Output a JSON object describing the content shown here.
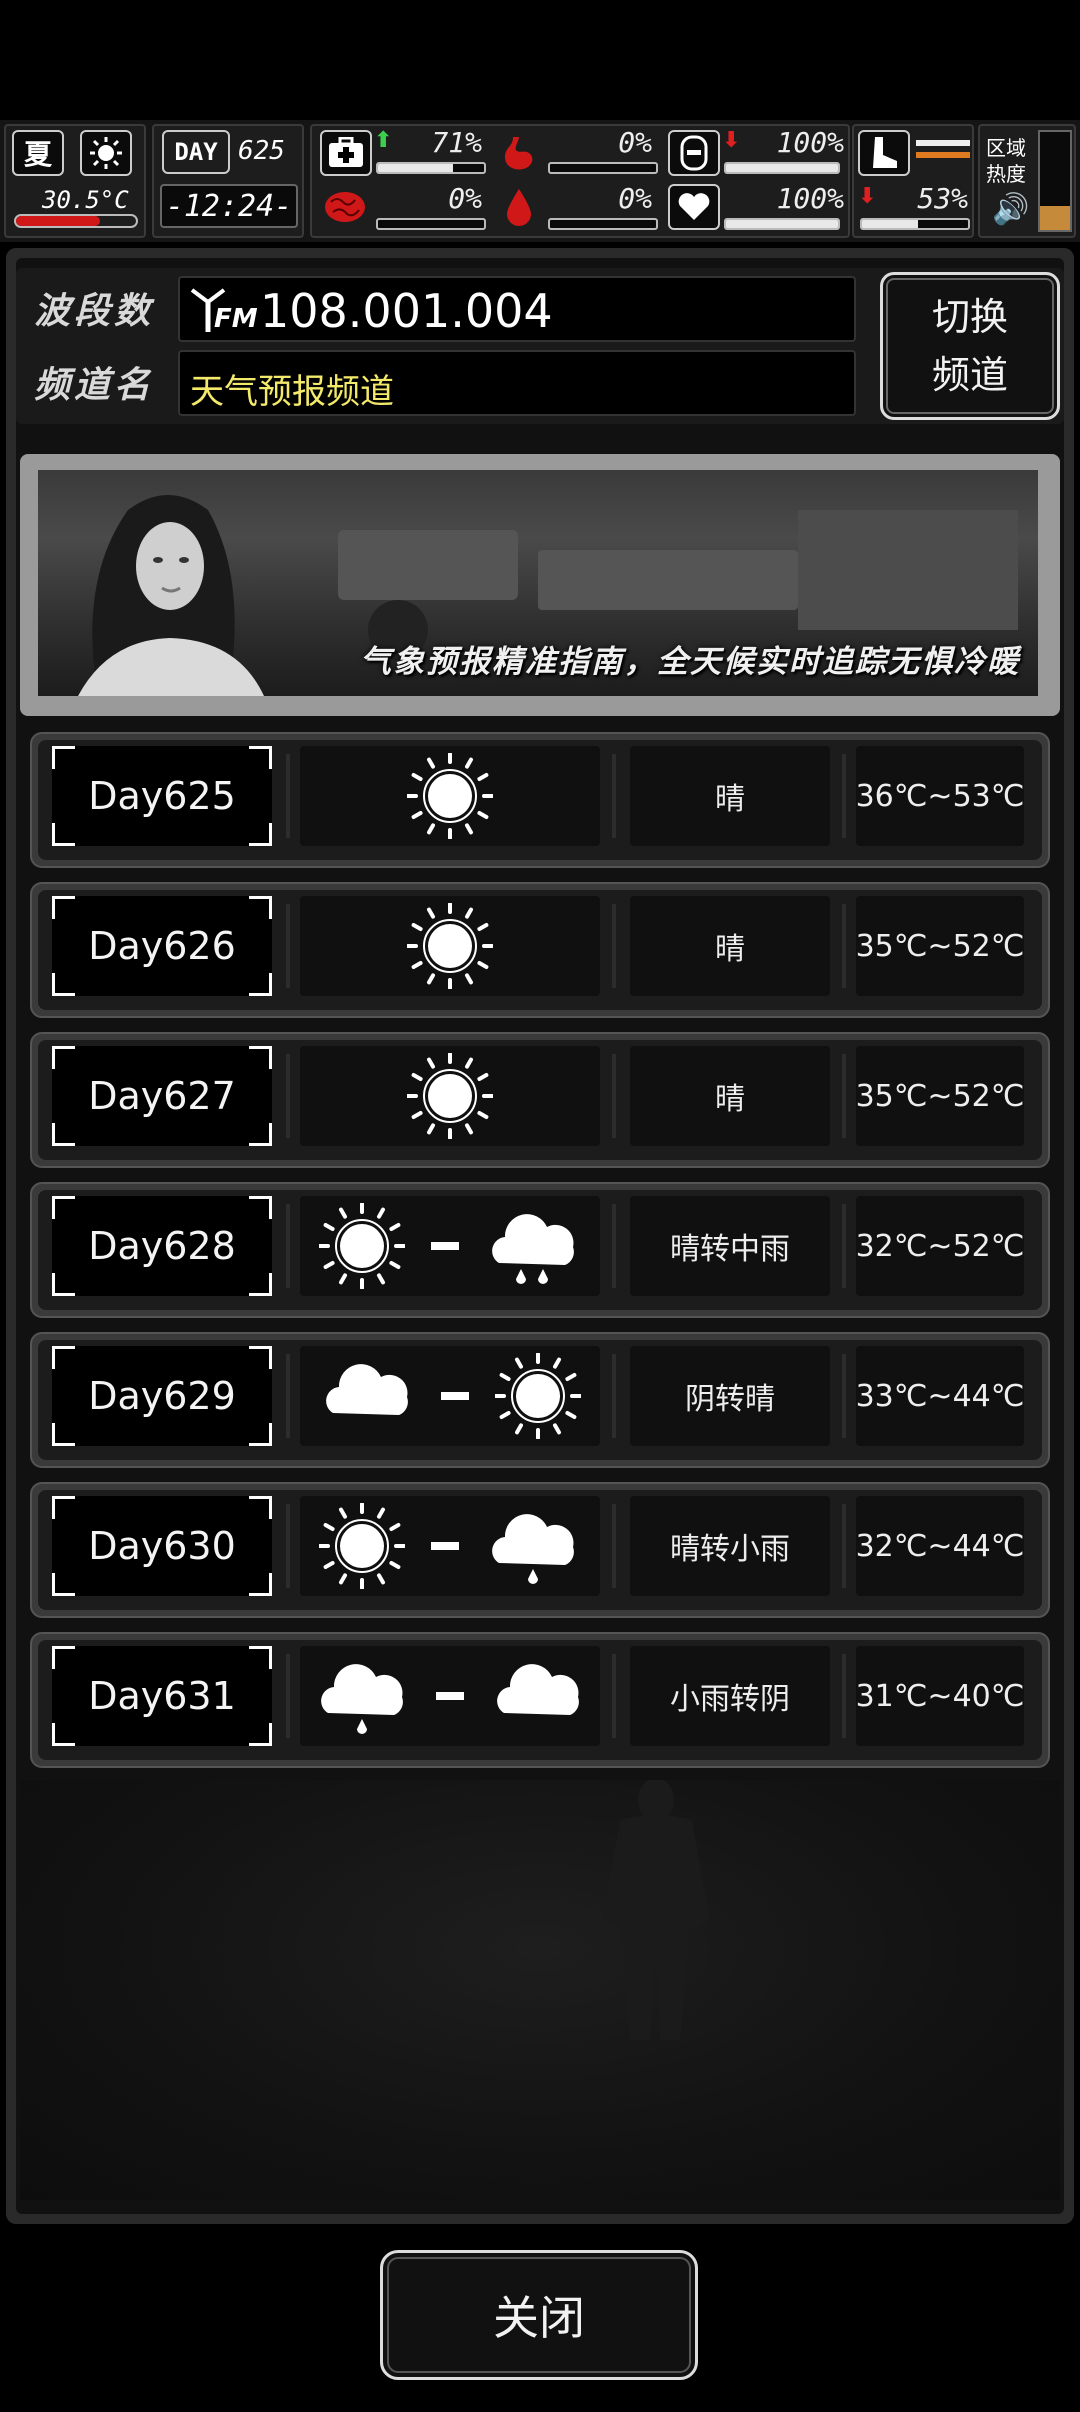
{
  "status_bar": {
    "season": "夏",
    "temperature": "30.5°C",
    "day_label": "DAY",
    "day_number": "625",
    "clock": "-12:24-",
    "stats": [
      {
        "name": "health",
        "value": "71%",
        "fill": 0.71,
        "trend": "up"
      },
      {
        "name": "hunger",
        "value": "0%",
        "fill": 0.0,
        "trend": "none"
      },
      {
        "name": "stamina",
        "value": "100%",
        "fill": 1.0,
        "trend": "down"
      },
      {
        "name": "sanity",
        "value": "0%",
        "fill": 0.0,
        "trend": "none"
      },
      {
        "name": "thirst",
        "value": "0%",
        "fill": 0.0,
        "trend": "none"
      },
      {
        "name": "mood",
        "value": "100%",
        "fill": 1.0,
        "trend": "none"
      },
      {
        "name": "leg-condition",
        "value": "53%",
        "fill": 0.53,
        "trend": "down"
      }
    ],
    "zone_heat_label_1": "区域",
    "zone_heat_label_2": "热度",
    "zone_heat_level": 0.25
  },
  "radio": {
    "band_label": "波段数",
    "channel_label": "频道名",
    "fm_tag": "FM",
    "frequency": "108.001.004",
    "channel_name": "天气预报频道",
    "switch_label_1": "切换",
    "switch_label_2": "频道"
  },
  "banner": {
    "caption": "气象预报精准指南，全天候实时追踪无惧冷暖"
  },
  "forecast": [
    {
      "day": "Day625",
      "icons": [
        "sun"
      ],
      "desc": "晴",
      "temp": "36℃~53℃"
    },
    {
      "day": "Day626",
      "icons": [
        "sun"
      ],
      "desc": "晴",
      "temp": "35℃~52℃"
    },
    {
      "day": "Day627",
      "icons": [
        "sun"
      ],
      "desc": "晴",
      "temp": "35℃~52℃"
    },
    {
      "day": "Day628",
      "icons": [
        "sun",
        "heavy-rain"
      ],
      "desc": "晴转中雨",
      "temp": "32℃~52℃"
    },
    {
      "day": "Day629",
      "icons": [
        "cloud",
        "sun"
      ],
      "desc": "阴转晴",
      "temp": "33℃~44℃"
    },
    {
      "day": "Day630",
      "icons": [
        "sun",
        "light-rain"
      ],
      "desc": "晴转小雨",
      "temp": "32℃~44℃"
    },
    {
      "day": "Day631",
      "icons": [
        "light-rain",
        "cloud"
      ],
      "desc": "小雨转阴",
      "temp": "31℃~40℃"
    }
  ],
  "footer": {
    "close_label": "关闭"
  },
  "colors": {
    "channel_name": "#f3e96a",
    "stat_up": "#3ccf4e",
    "stat_down": "#e02020",
    "stat_icon_red": "#d01818",
    "heat_bar": "#c58a3a"
  }
}
